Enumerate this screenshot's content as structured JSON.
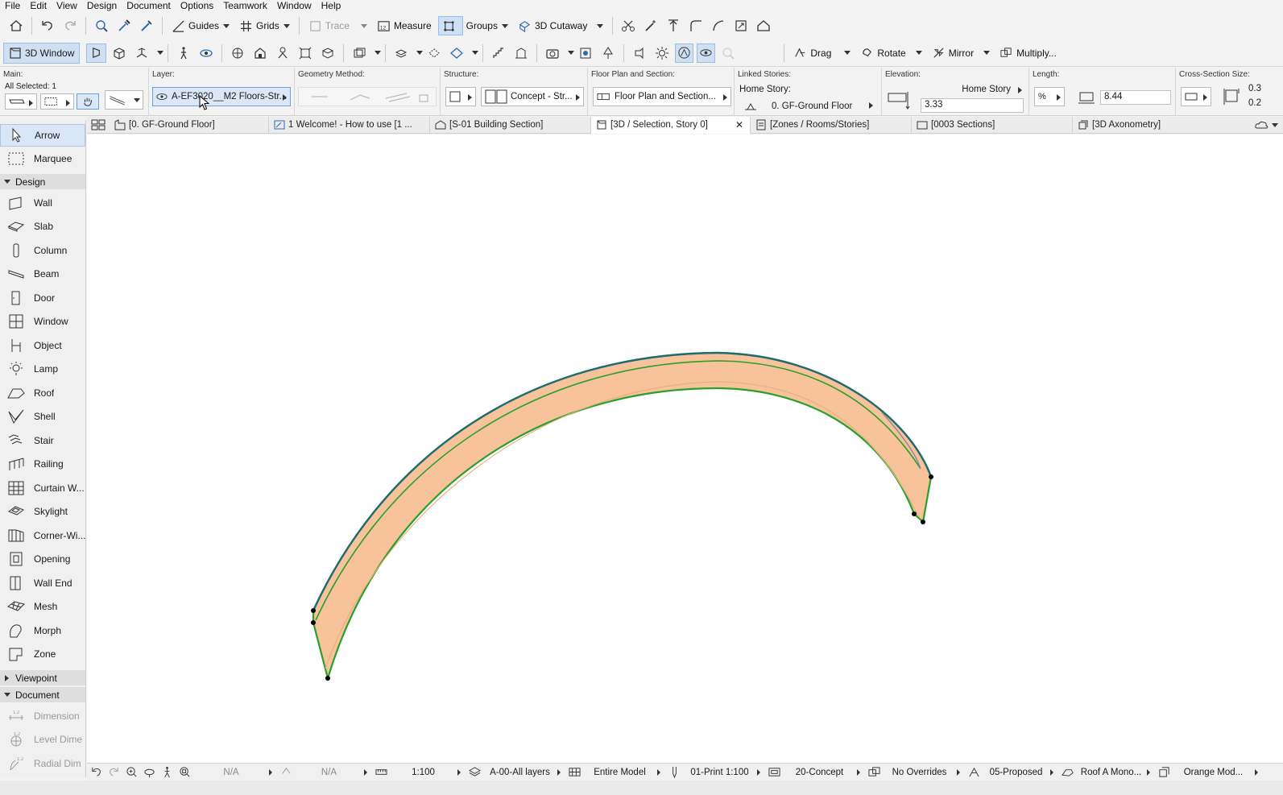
{
  "menubar": {
    "items": [
      "File",
      "Edit",
      "View",
      "Design",
      "Document",
      "Options",
      "Teamwork",
      "Window",
      "Help"
    ]
  },
  "toolbar": {
    "guides": "Guides",
    "grids": "Grids",
    "trace": "Trace",
    "measure": "Measure",
    "groups": "Groups",
    "cutaway": "3D Cutaway",
    "window3d": "3D Window",
    "drag": "Drag",
    "rotate": "Rotate",
    "mirror": "Mirror",
    "multiply": "Multiply..."
  },
  "infobox": {
    "main_label": "Main:",
    "all_selected": "All Selected: 1",
    "layer_label": "Layer:",
    "layer_value": "A-EF3020__M2 Floors-Str...",
    "geometry_label": "Geometry Method:",
    "structure_label": "Structure:",
    "structure_value": "Concept - Str...",
    "floorplan_label": "Floor Plan and Section:",
    "floorplan_value": "Floor Plan and Section...",
    "linked_label": "Linked Stories:",
    "home_story_label": "Home Story:",
    "home_story_value": "0. GF-Ground Floor",
    "elevation_label": "Elevation:",
    "elevation_ref": "Home Story",
    "elevation_value": "3.33",
    "length_label": "Length:",
    "length_value": "8.44",
    "cross_label": "Cross-Section Size:",
    "cross_val1": "0.3",
    "cross_val2": "0.2"
  },
  "tabs": [
    {
      "label": "[0. GF-Ground Floor]"
    },
    {
      "label": "1 Welcome! - How to use [1 ..."
    },
    {
      "label": "[S-01 Building Section]"
    },
    {
      "label": "[3D / Selection, Story 0]"
    },
    {
      "label": "[Zones / Rooms/Stories]"
    },
    {
      "label": "[0003 Sections]"
    },
    {
      "label": "[3D Axonometry]"
    }
  ],
  "tab_close": "✕",
  "toolbox": {
    "arrow": "Arrow",
    "marquee": "Marquee",
    "design_header": "Design",
    "design_tools": [
      "Wall",
      "Slab",
      "Column",
      "Beam",
      "Door",
      "Window",
      "Object",
      "Lamp",
      "Roof",
      "Shell",
      "Stair",
      "Railing",
      "Curtain W...",
      "Skylight",
      "Corner-Wi...",
      "Opening",
      "Wall End",
      "Mesh",
      "Morph",
      "Zone"
    ],
    "viewpoint_header": "Viewpoint",
    "document_header": "Document",
    "document_tools": [
      "Dimension",
      "Level Dime",
      "Radial Dim"
    ]
  },
  "statusbar": {
    "na1": "N/A",
    "na2": "N/A",
    "scale": "1:100",
    "layers": "A-00-All layers",
    "model": "Entire Model",
    "pen": "01-Print 1:100",
    "mvo": "20-Concept",
    "overrides": "No Overrides",
    "renovation": "05-Proposed",
    "dimension": "Roof A Mono...",
    "model_view": "Orange Mod..."
  },
  "colors": {
    "beam_fill": "#f8c29b",
    "beam_outline": "#2aa02a",
    "beam_top_edge": "#1f6b70",
    "selection_blue": "#cfe0f3"
  }
}
